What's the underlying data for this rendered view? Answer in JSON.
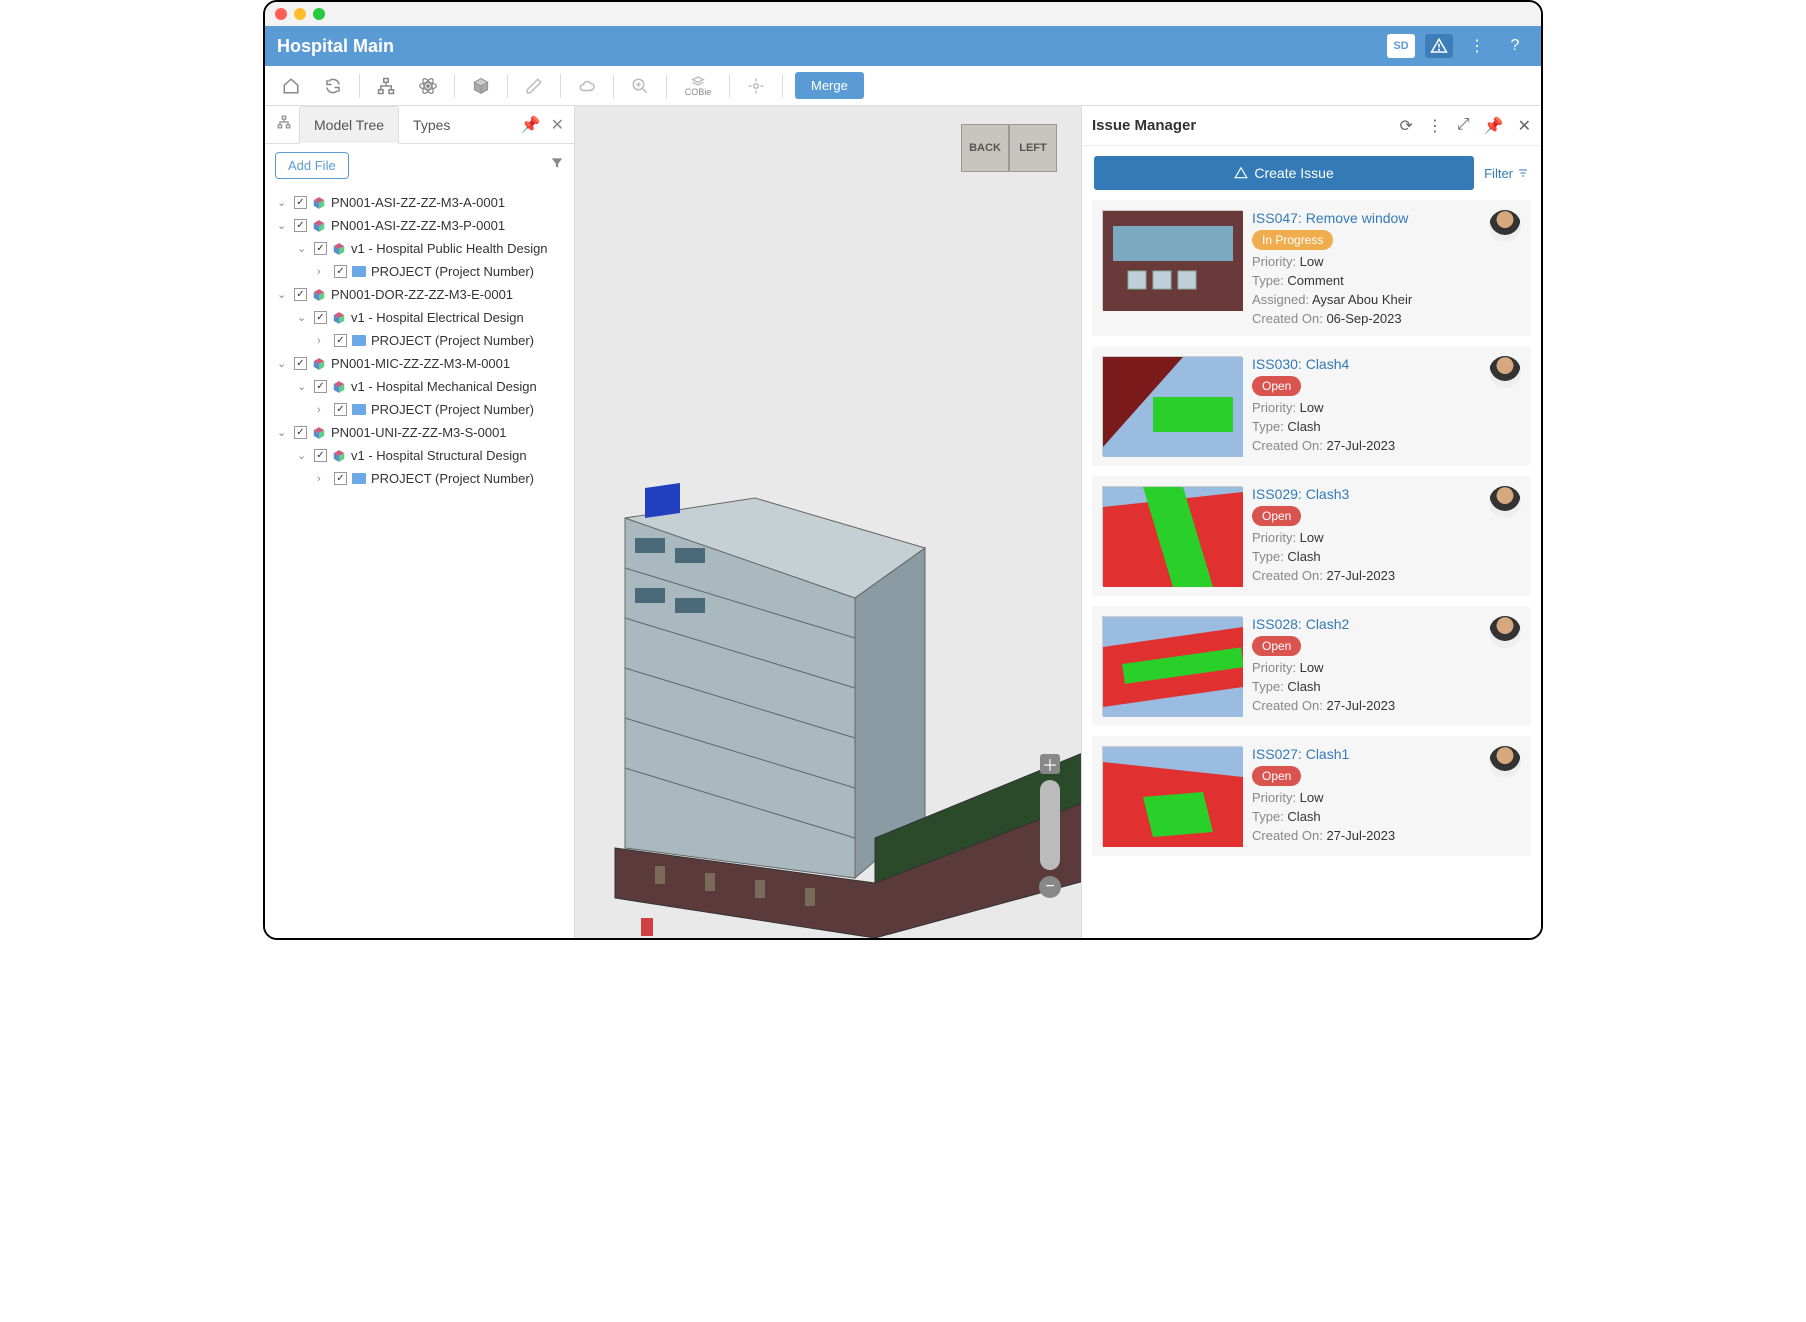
{
  "header": {
    "title": "Hospital Main",
    "sd": "SD"
  },
  "toolbar": {
    "cobie": "COBie",
    "merge": "Merge"
  },
  "tabs": {
    "model_tree": "Model Tree",
    "types": "Types"
  },
  "tree": {
    "add_file": "Add File",
    "nodes": [
      {
        "label": "PN001-ASI-ZZ-ZZ-M3-A-0001",
        "indent": 0,
        "type": "file"
      },
      {
        "label": "PN001-ASI-ZZ-ZZ-M3-P-0001",
        "indent": 0,
        "type": "file"
      },
      {
        "label": "v1 - Hospital Public Health Design",
        "indent": 1,
        "type": "file"
      },
      {
        "label": "PROJECT (Project Number)",
        "indent": 2,
        "type": "project"
      },
      {
        "label": "PN001-DOR-ZZ-ZZ-M3-E-0001",
        "indent": 0,
        "type": "file"
      },
      {
        "label": "v1 - Hospital Electrical Design",
        "indent": 1,
        "type": "file"
      },
      {
        "label": "PROJECT (Project Number)",
        "indent": 2,
        "type": "project"
      },
      {
        "label": "PN001-MIC-ZZ-ZZ-M3-M-0001",
        "indent": 0,
        "type": "file"
      },
      {
        "label": "v1 - Hospital Mechanical Design",
        "indent": 1,
        "type": "file"
      },
      {
        "label": "PROJECT (Project Number)",
        "indent": 2,
        "type": "project"
      },
      {
        "label": "PN001-UNI-ZZ-ZZ-M3-S-0001",
        "indent": 0,
        "type": "file"
      },
      {
        "label": "v1 - Hospital Structural Design",
        "indent": 1,
        "type": "file"
      },
      {
        "label": "PROJECT (Project Number)",
        "indent": 2,
        "type": "project"
      }
    ]
  },
  "viewcube": {
    "back": "BACK",
    "left": "LEFT"
  },
  "issue_manager": {
    "title": "Issue Manager",
    "create": "Create Issue",
    "filter": "Filter",
    "labels": {
      "priority": "Priority:",
      "type": "Type:",
      "assigned": "Assigned:",
      "created": "Created On:"
    },
    "issues": [
      {
        "title": "ISS047: Remove window",
        "status": "In Progress",
        "status_class": "inprogress",
        "priority": "Low",
        "type": "Comment",
        "assigned": "Aysar Abou Kheir",
        "created": "06-Sep-2023",
        "thumb": "win"
      },
      {
        "title": "ISS030: Clash4",
        "status": "Open",
        "status_class": "open",
        "priority": "Low",
        "type": "Clash",
        "assigned": "",
        "created": "27-Jul-2023",
        "thumb": "clash1"
      },
      {
        "title": "ISS029: Clash3",
        "status": "Open",
        "status_class": "open",
        "priority": "Low",
        "type": "Clash",
        "assigned": "",
        "created": "27-Jul-2023",
        "thumb": "clash2"
      },
      {
        "title": "ISS028: Clash2",
        "status": "Open",
        "status_class": "open",
        "priority": "Low",
        "type": "Clash",
        "assigned": "",
        "created": "27-Jul-2023",
        "thumb": "clash3"
      },
      {
        "title": "ISS027: Clash1",
        "status": "Open",
        "status_class": "open",
        "priority": "Low",
        "type": "Clash",
        "assigned": "",
        "created": "27-Jul-2023",
        "thumb": "clash4"
      }
    ]
  }
}
